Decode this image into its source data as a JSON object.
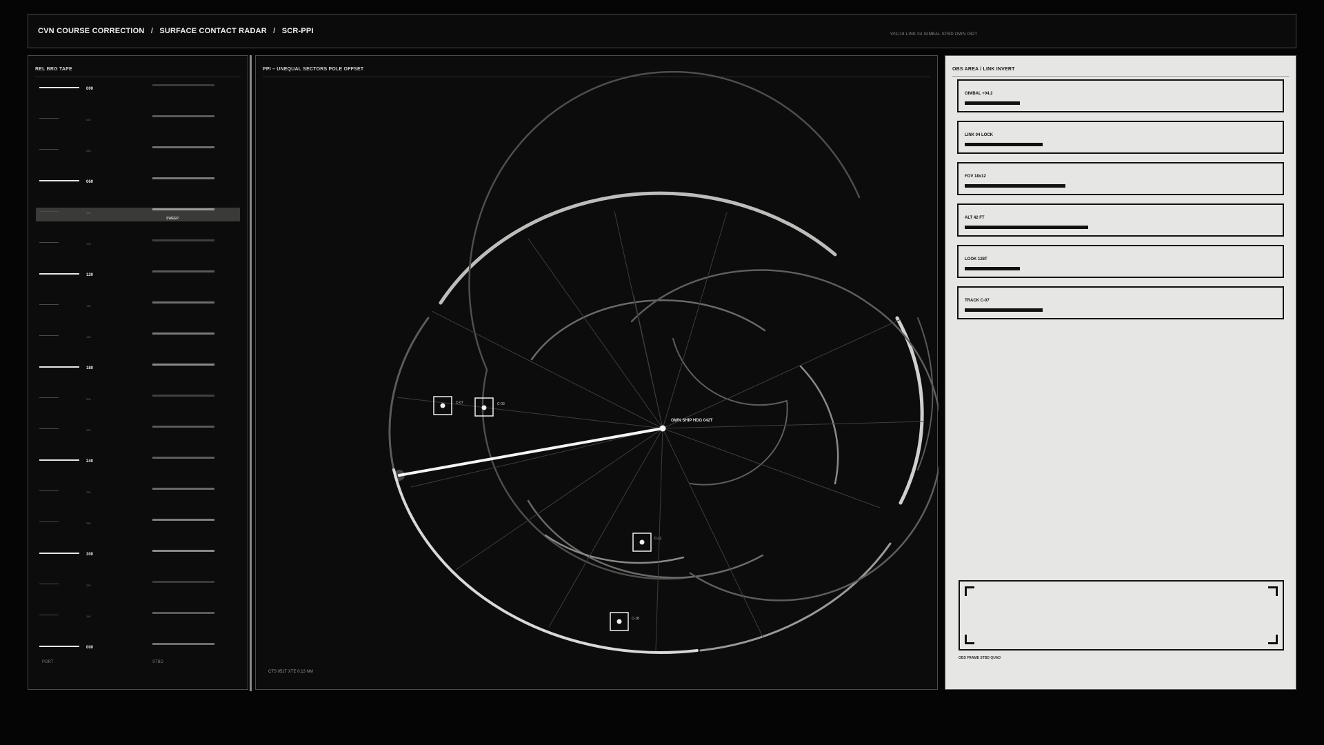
{
  "header": {
    "title_parts": [
      "CVN COURSE CORRECTION",
      "SURFACE CONTACT RADAR",
      "SCR-PPI"
    ],
    "separator": "/",
    "status": "V01/18   LINK 04   GIMBAL STBD   OWN 042T"
  },
  "left_panel": {
    "label": "REL BRG TAPE",
    "sweep_label": "SWEEP",
    "port_label": "PORT",
    "stbd_label": "STBD",
    "ticks": [
      {
        "label": "000",
        "major": true
      },
      {
        "label": "020",
        "major": false
      },
      {
        "label": "040",
        "major": false
      },
      {
        "label": "060",
        "major": true
      },
      {
        "label": "080",
        "major": false
      },
      {
        "label": "100",
        "major": false
      },
      {
        "label": "120",
        "major": true
      },
      {
        "label": "140",
        "major": false
      },
      {
        "label": "160",
        "major": false
      },
      {
        "label": "180",
        "major": true
      },
      {
        "label": "200",
        "major": false
      },
      {
        "label": "220",
        "major": false
      },
      {
        "label": "240",
        "major": true
      },
      {
        "label": "260",
        "major": false
      },
      {
        "label": "280",
        "major": false
      },
      {
        "label": "300",
        "major": true
      },
      {
        "label": "320",
        "major": false
      },
      {
        "label": "340",
        "major": false
      },
      {
        "label": "000",
        "major": true
      }
    ]
  },
  "center_panel": {
    "label": "PPI – UNEQUAL SECTORS  POLE OFFSET",
    "own_ship_label": "OWN SHIP  HDG 042T",
    "cts_label": "CTS 051T   XTE 0.13 NM",
    "contacts": [
      {
        "id": "C-07"
      },
      {
        "id": "C-03"
      },
      {
        "id": "C-11"
      },
      {
        "id": "C-18"
      }
    ]
  },
  "right_panel": {
    "label": "OBS AREA / LINK INVERT",
    "items": [
      {
        "label": "GIMBAL +04.2",
        "level": 0.17
      },
      {
        "label": "LINK 04 LOCK",
        "level": 0.24
      },
      {
        "label": "FOV 18x12",
        "level": 0.31
      },
      {
        "label": "ALT 42 FT",
        "level": 0.38
      },
      {
        "label": "LOOK 128T",
        "level": 0.17
      },
      {
        "label": "TRACK C-07",
        "level": 0.24
      }
    ],
    "frame_label": "OBS FRAME  STBD QUAD"
  },
  "colors": {
    "background": "#050505",
    "panel": "#0b0c0b",
    "light_panel": "#e6e7e4",
    "accent": "#f0f0f0"
  }
}
